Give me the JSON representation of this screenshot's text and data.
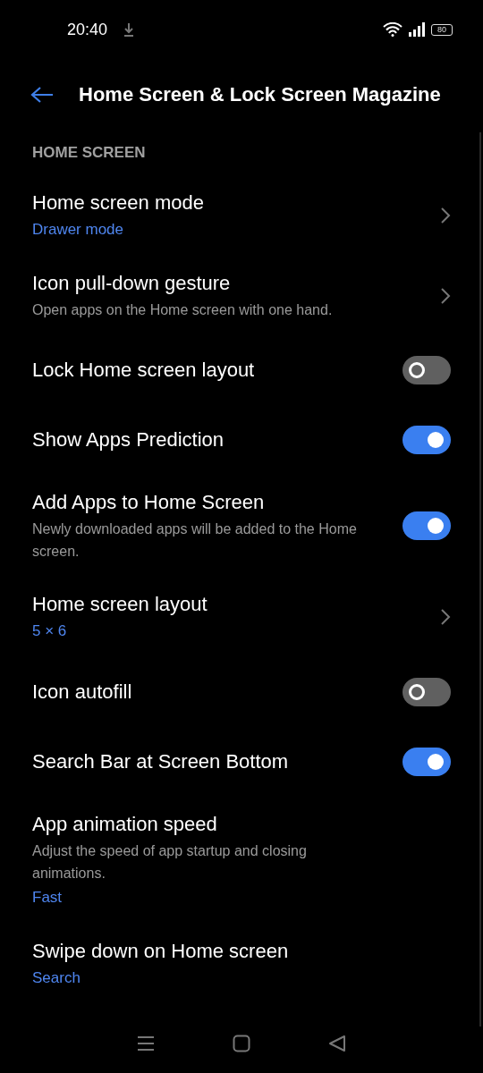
{
  "status_bar": {
    "time": "20:40",
    "battery": "80"
  },
  "header": {
    "title": "Home Screen & Lock Screen Magazine"
  },
  "section": {
    "title": "HOME SCREEN"
  },
  "items": [
    {
      "kind": "link",
      "title": "Home screen mode",
      "value": "Drawer mode"
    },
    {
      "kind": "link",
      "title": "Icon pull-down gesture",
      "subtitle": "Open apps on the Home screen with one hand."
    },
    {
      "kind": "toggle",
      "title": "Lock Home screen layout",
      "on": false
    },
    {
      "kind": "toggle",
      "title": "Show Apps Prediction",
      "on": true
    },
    {
      "kind": "toggle",
      "title": "Add Apps to Home Screen",
      "subtitle": "Newly downloaded apps will be added to the Home screen.",
      "on": true
    },
    {
      "kind": "link",
      "title": "Home screen layout",
      "value": "5 × 6"
    },
    {
      "kind": "toggle",
      "title": "Icon autofill",
      "on": false
    },
    {
      "kind": "toggle",
      "title": "Search Bar at Screen Bottom",
      "on": true
    },
    {
      "kind": "plain",
      "title": "App animation speed",
      "subtitle": "Adjust the speed of app startup and closing animations.",
      "value": "Fast"
    },
    {
      "kind": "plain",
      "title": "Swipe down on Home screen",
      "value": "Search"
    }
  ]
}
